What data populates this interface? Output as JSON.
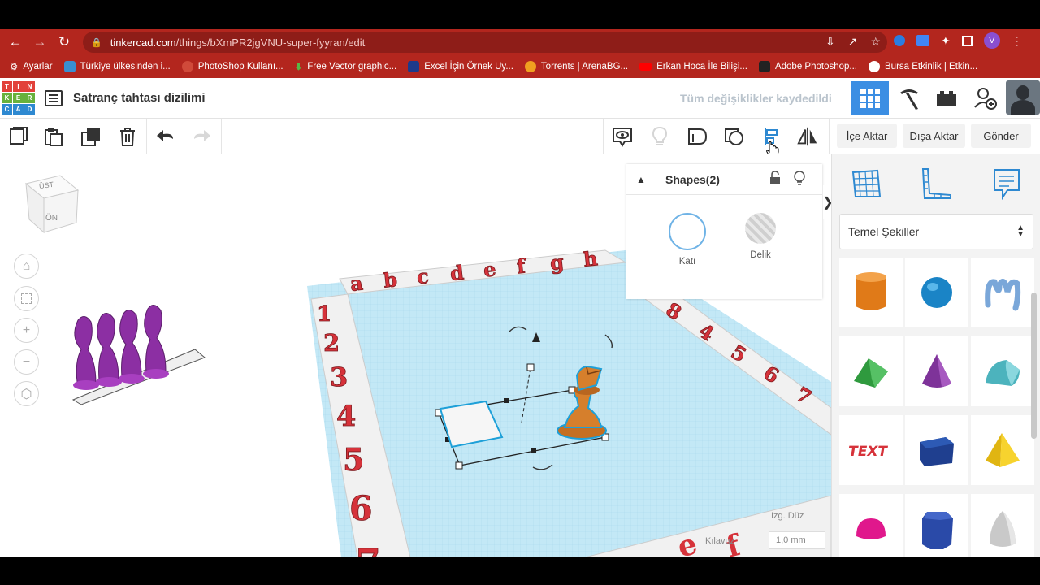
{
  "browser": {
    "url_host": "tinkercad.com",
    "url_path": "/things/bXmPR2jgVNU-super-fyyran/edit",
    "profile_initial": "V",
    "bookmarks": [
      {
        "label": "Ayarlar",
        "icon": "gear-icon",
        "color": "#ffffff"
      },
      {
        "label": "Türkiye ülkesinden i...",
        "icon": "chart-icon",
        "color": "#3a8fd0"
      },
      {
        "label": "PhotoShop Kullanı...",
        "icon": "web-icon",
        "color": "#d04a3a"
      },
      {
        "label": "Free Vector graphic...",
        "icon": "download-icon",
        "color": "#57b846"
      },
      {
        "label": "Excel İçin Örnek Uy...",
        "icon": "doc-icon",
        "color": "#1d3a8a"
      },
      {
        "label": "Torrents | ArenaBG...",
        "icon": "circle-icon",
        "color": "#f0a020"
      },
      {
        "label": "Erkan Hoca İle Bilişi...",
        "icon": "youtube-icon",
        "color": "#ff0000"
      },
      {
        "label": "Adobe Photoshop...",
        "icon": "adobe-icon",
        "color": "#222222"
      },
      {
        "label": "Bursa Etkinlik | Etkin...",
        "icon": "globe-icon",
        "color": "#ffffff"
      }
    ]
  },
  "app": {
    "logo_letters": [
      "T",
      "I",
      "N",
      "K",
      "E",
      "R",
      "C",
      "A",
      "D"
    ],
    "logo_colors": [
      "#e2413a",
      "#e2413a",
      "#e2413a",
      "#67b13c",
      "#67b13c",
      "#67b13c",
      "#2e89d1",
      "#2e89d1",
      "#2e89d1"
    ],
    "title": "Satranç tahtası dizilimi",
    "save_status": "Tüm değişiklikler kaydedildi",
    "accent": "#3b8ee3"
  },
  "toolbar": {
    "import_label": "İçe Aktar",
    "export_label": "Dışa Aktar",
    "send_label": "Gönder"
  },
  "viewcube": {
    "top_label": "ÜST",
    "front_label": "ÖN"
  },
  "inspector": {
    "title": "Shapes(2)",
    "solid_label": "Katı",
    "hole_label": "Delik"
  },
  "grid": {
    "edit_label": "Izg. Düz",
    "snap_label": "Kılavuz",
    "snap_value": "1,0 mm"
  },
  "board": {
    "letters": [
      "a",
      "b",
      "c",
      "d",
      "e",
      "f",
      "g",
      "h"
    ],
    "numbers": [
      "1",
      "2",
      "3",
      "4",
      "5",
      "6",
      "7"
    ],
    "right_numbers": [
      "8",
      "4",
      "5",
      "6",
      "7"
    ],
    "label_color": "#d6323a"
  },
  "library": {
    "category": "Temel Şekiller",
    "shapes": [
      {
        "name": "box-cylinder",
        "color": "#e8821e"
      },
      {
        "name": "sphere",
        "color": "#1f8fd2"
      },
      {
        "name": "scribble",
        "color": "#7aa7d9"
      },
      {
        "name": "roof",
        "color": "#3aa84a"
      },
      {
        "name": "cone",
        "color": "#8b3fa7"
      },
      {
        "name": "round-roof",
        "color": "#5cc1c9"
      },
      {
        "name": "text",
        "color": "#d6323a"
      },
      {
        "name": "box",
        "color": "#1f3f8f"
      },
      {
        "name": "pyramid",
        "color": "#f2c81b"
      },
      {
        "name": "half-sphere",
        "color": "#e0188c"
      },
      {
        "name": "polygon",
        "color": "#2a4aa8"
      },
      {
        "name": "paraboloid",
        "color": "#c9c9c9"
      }
    ]
  }
}
